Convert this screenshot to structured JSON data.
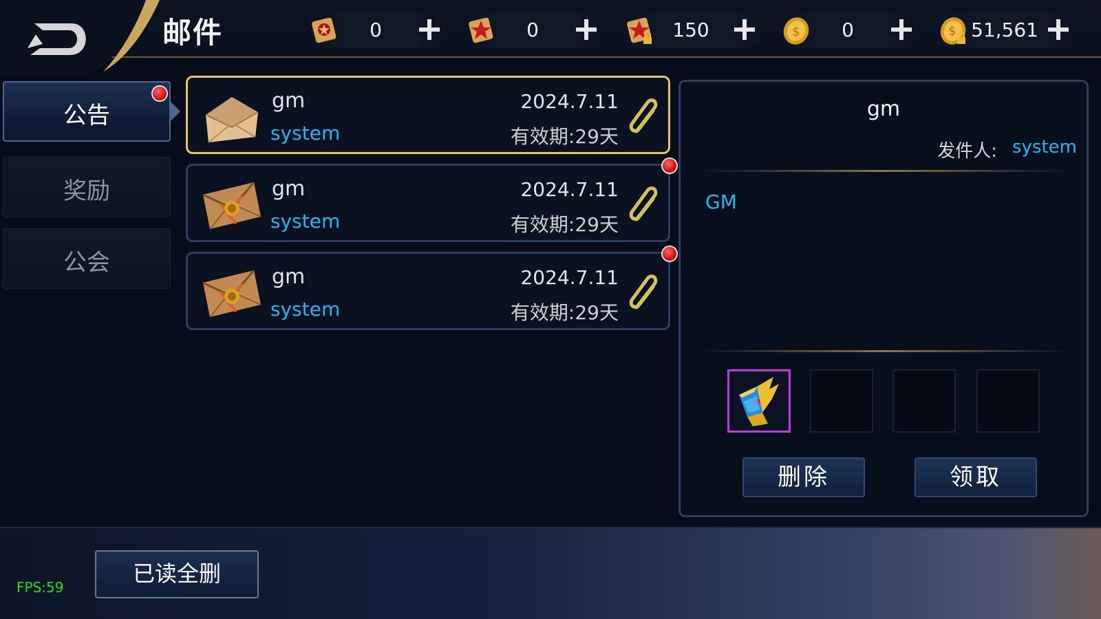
{
  "header": {
    "title": "邮件",
    "resources": [
      {
        "icon": "scroll-pentagram-icon",
        "value": "0",
        "plus": "add-icon"
      },
      {
        "icon": "scroll-star-icon",
        "value": "0",
        "plus": "add-icon"
      },
      {
        "icon": "scroll-star-locked-icon",
        "value": "150",
        "plus": "add-icon"
      },
      {
        "icon": "gold-coin-icon",
        "value": "0",
        "plus": "add-icon"
      },
      {
        "icon": "gold-coin-locked-icon",
        "value": "51,561",
        "plus": "add-icon"
      }
    ]
  },
  "tabs": [
    {
      "label": "公告",
      "active": true,
      "unread": true
    },
    {
      "label": "奖励",
      "active": false,
      "unread": false
    },
    {
      "label": "公会",
      "active": false,
      "unread": false
    }
  ],
  "mails": [
    {
      "subject": "gm",
      "sender": "system",
      "date": "2024.7.11",
      "expiry": "有效期:29天",
      "opened": true,
      "unread": false,
      "has_attachment": true
    },
    {
      "subject": "gm",
      "sender": "system",
      "date": "2024.7.11",
      "expiry": "有效期:29天",
      "opened": false,
      "unread": true,
      "has_attachment": true
    },
    {
      "subject": "gm",
      "sender": "system",
      "date": "2024.7.11",
      "expiry": "有效期:29天",
      "opened": false,
      "unread": true,
      "has_attachment": true
    }
  ],
  "detail": {
    "subject": "gm",
    "sender_label": "发件人:",
    "sender": "system",
    "body": "GM",
    "attachments": [
      {
        "icon": "golden-winged-gem-icon"
      }
    ],
    "delete_label": "删除",
    "claim_label": "领取"
  },
  "footer": {
    "delete_read_label": "已读全删",
    "fps": "FPS:59"
  },
  "colors": {
    "accent_blue": "#26b7f0",
    "selected_border": "#e8c564",
    "attachment_rare_border": "#c13ad6",
    "fps_green": "#1fe01f"
  }
}
